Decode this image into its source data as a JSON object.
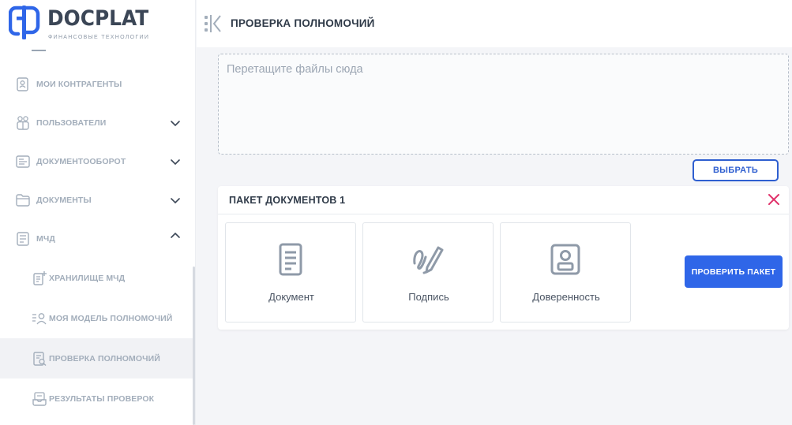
{
  "brand": {
    "name": "DOCPLAT",
    "tagline": "ФИНАНСОВЫЕ ТЕХНОЛОГИИ",
    "color": "#2f66e8"
  },
  "sidebar": {
    "items": [
      {
        "label": "МОИ КОНТРАГЕНТЫ",
        "icon": "contractors-icon"
      },
      {
        "label": "ПОЛЬЗОВАТЕЛИ",
        "icon": "users-icon",
        "chevron": "chevron-down-icon"
      },
      {
        "label": "ДОКУМЕНТООБОРОТ",
        "icon": "workflow-icon",
        "chevron": "chevron-down-icon"
      },
      {
        "label": "ДОКУМЕНТЫ",
        "icon": "folder-icon",
        "chevron": "chevron-down-icon"
      },
      {
        "label": "МЧД",
        "icon": "poa-list-icon",
        "chevron": "chevron-up-icon"
      },
      {
        "label": "ХРАНИЛИЩЕ МЧД",
        "icon": "storage-icon"
      },
      {
        "label": "МОЯ МОДЕЛЬ ПОЛНОМОЧИЙ",
        "icon": "authority-model-icon"
      },
      {
        "label": "ПРОВЕРКА ПОЛНОМОЧИЙ",
        "icon": "check-authority-icon",
        "active": true
      },
      {
        "label": "РЕЗУЛЬТАТЫ ПРОВЕРОК",
        "icon": "results-icon"
      }
    ]
  },
  "header": {
    "title": "ПРОВЕРКА ПОЛНОМОЧИЙ",
    "icon": "collapse-sidebar-icon"
  },
  "dropzone": {
    "placeholder": "Перетащите файлы сюда"
  },
  "choose_button": "ВЫБРАТЬ",
  "package": {
    "title": "ПАКЕТ ДОКУМЕНТОВ 1",
    "close_icon": "close-icon",
    "close_color": "#e0336b",
    "tiles": [
      {
        "label": "Документ",
        "icon": "document-icon"
      },
      {
        "label": "Подпись",
        "icon": "signature-icon"
      },
      {
        "label": "Доверенность",
        "icon": "power-of-attorney-icon"
      }
    ],
    "check_button": "ПРОВЕРИТЬ ПАКЕТ"
  }
}
